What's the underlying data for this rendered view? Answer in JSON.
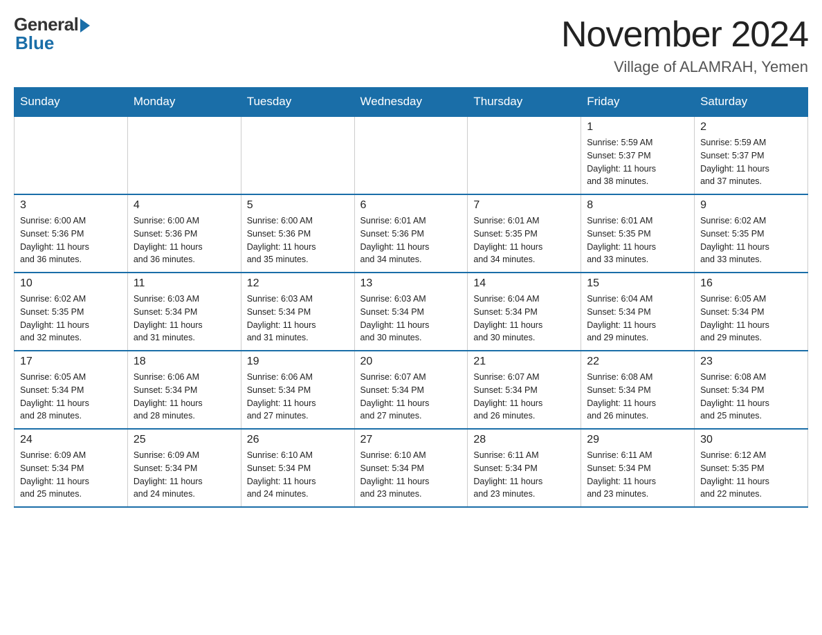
{
  "header": {
    "logo_general": "General",
    "logo_blue": "Blue",
    "month_title": "November 2024",
    "location": "Village of ALAMRAH, Yemen"
  },
  "weekdays": [
    "Sunday",
    "Monday",
    "Tuesday",
    "Wednesday",
    "Thursday",
    "Friday",
    "Saturday"
  ],
  "weeks": [
    [
      {
        "day": "",
        "info": ""
      },
      {
        "day": "",
        "info": ""
      },
      {
        "day": "",
        "info": ""
      },
      {
        "day": "",
        "info": ""
      },
      {
        "day": "",
        "info": ""
      },
      {
        "day": "1",
        "info": "Sunrise: 5:59 AM\nSunset: 5:37 PM\nDaylight: 11 hours\nand 38 minutes."
      },
      {
        "day": "2",
        "info": "Sunrise: 5:59 AM\nSunset: 5:37 PM\nDaylight: 11 hours\nand 37 minutes."
      }
    ],
    [
      {
        "day": "3",
        "info": "Sunrise: 6:00 AM\nSunset: 5:36 PM\nDaylight: 11 hours\nand 36 minutes."
      },
      {
        "day": "4",
        "info": "Sunrise: 6:00 AM\nSunset: 5:36 PM\nDaylight: 11 hours\nand 36 minutes."
      },
      {
        "day": "5",
        "info": "Sunrise: 6:00 AM\nSunset: 5:36 PM\nDaylight: 11 hours\nand 35 minutes."
      },
      {
        "day": "6",
        "info": "Sunrise: 6:01 AM\nSunset: 5:36 PM\nDaylight: 11 hours\nand 34 minutes."
      },
      {
        "day": "7",
        "info": "Sunrise: 6:01 AM\nSunset: 5:35 PM\nDaylight: 11 hours\nand 34 minutes."
      },
      {
        "day": "8",
        "info": "Sunrise: 6:01 AM\nSunset: 5:35 PM\nDaylight: 11 hours\nand 33 minutes."
      },
      {
        "day": "9",
        "info": "Sunrise: 6:02 AM\nSunset: 5:35 PM\nDaylight: 11 hours\nand 33 minutes."
      }
    ],
    [
      {
        "day": "10",
        "info": "Sunrise: 6:02 AM\nSunset: 5:35 PM\nDaylight: 11 hours\nand 32 minutes."
      },
      {
        "day": "11",
        "info": "Sunrise: 6:03 AM\nSunset: 5:34 PM\nDaylight: 11 hours\nand 31 minutes."
      },
      {
        "day": "12",
        "info": "Sunrise: 6:03 AM\nSunset: 5:34 PM\nDaylight: 11 hours\nand 31 minutes."
      },
      {
        "day": "13",
        "info": "Sunrise: 6:03 AM\nSunset: 5:34 PM\nDaylight: 11 hours\nand 30 minutes."
      },
      {
        "day": "14",
        "info": "Sunrise: 6:04 AM\nSunset: 5:34 PM\nDaylight: 11 hours\nand 30 minutes."
      },
      {
        "day": "15",
        "info": "Sunrise: 6:04 AM\nSunset: 5:34 PM\nDaylight: 11 hours\nand 29 minutes."
      },
      {
        "day": "16",
        "info": "Sunrise: 6:05 AM\nSunset: 5:34 PM\nDaylight: 11 hours\nand 29 minutes."
      }
    ],
    [
      {
        "day": "17",
        "info": "Sunrise: 6:05 AM\nSunset: 5:34 PM\nDaylight: 11 hours\nand 28 minutes."
      },
      {
        "day": "18",
        "info": "Sunrise: 6:06 AM\nSunset: 5:34 PM\nDaylight: 11 hours\nand 28 minutes."
      },
      {
        "day": "19",
        "info": "Sunrise: 6:06 AM\nSunset: 5:34 PM\nDaylight: 11 hours\nand 27 minutes."
      },
      {
        "day": "20",
        "info": "Sunrise: 6:07 AM\nSunset: 5:34 PM\nDaylight: 11 hours\nand 27 minutes."
      },
      {
        "day": "21",
        "info": "Sunrise: 6:07 AM\nSunset: 5:34 PM\nDaylight: 11 hours\nand 26 minutes."
      },
      {
        "day": "22",
        "info": "Sunrise: 6:08 AM\nSunset: 5:34 PM\nDaylight: 11 hours\nand 26 minutes."
      },
      {
        "day": "23",
        "info": "Sunrise: 6:08 AM\nSunset: 5:34 PM\nDaylight: 11 hours\nand 25 minutes."
      }
    ],
    [
      {
        "day": "24",
        "info": "Sunrise: 6:09 AM\nSunset: 5:34 PM\nDaylight: 11 hours\nand 25 minutes."
      },
      {
        "day": "25",
        "info": "Sunrise: 6:09 AM\nSunset: 5:34 PM\nDaylight: 11 hours\nand 24 minutes."
      },
      {
        "day": "26",
        "info": "Sunrise: 6:10 AM\nSunset: 5:34 PM\nDaylight: 11 hours\nand 24 minutes."
      },
      {
        "day": "27",
        "info": "Sunrise: 6:10 AM\nSunset: 5:34 PM\nDaylight: 11 hours\nand 23 minutes."
      },
      {
        "day": "28",
        "info": "Sunrise: 6:11 AM\nSunset: 5:34 PM\nDaylight: 11 hours\nand 23 minutes."
      },
      {
        "day": "29",
        "info": "Sunrise: 6:11 AM\nSunset: 5:34 PM\nDaylight: 11 hours\nand 23 minutes."
      },
      {
        "day": "30",
        "info": "Sunrise: 6:12 AM\nSunset: 5:35 PM\nDaylight: 11 hours\nand 22 minutes."
      }
    ]
  ]
}
